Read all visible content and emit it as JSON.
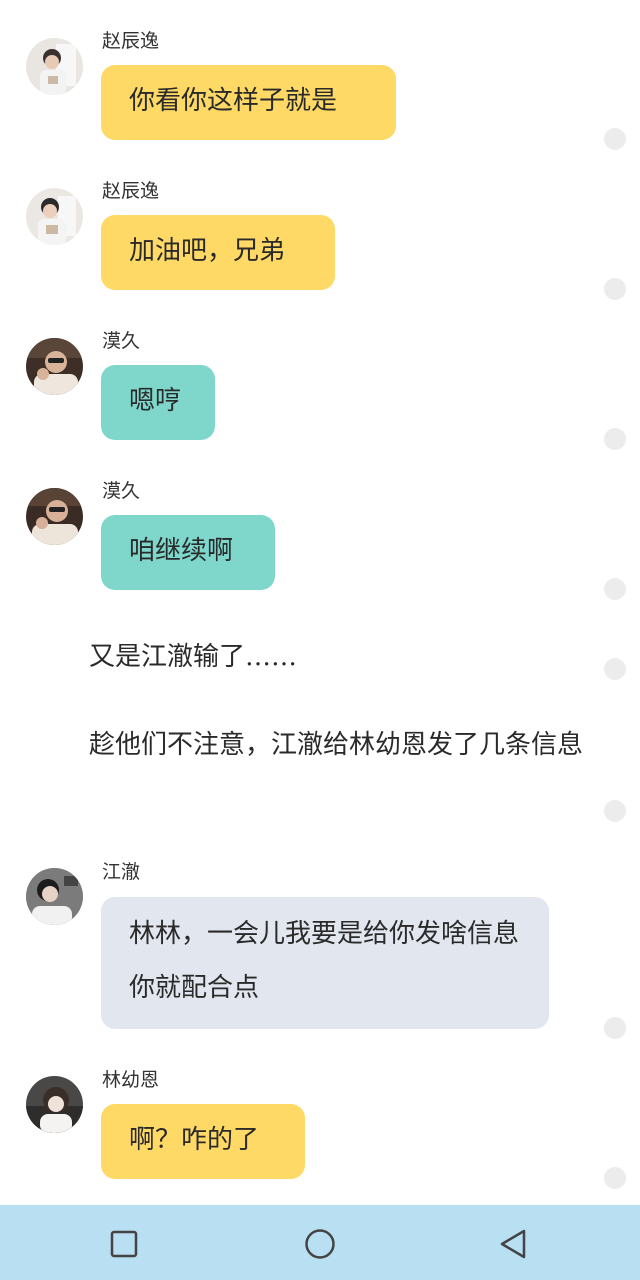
{
  "messages": [
    {
      "sender": "赵辰逸",
      "text": "你看你这样子就是",
      "color": "#ffd965"
    },
    {
      "sender": "赵辰逸",
      "text": "加油吧，兄弟",
      "color": "#ffd965"
    },
    {
      "sender": "漠久",
      "text": "嗯哼",
      "color": "#7fd7cc"
    },
    {
      "sender": "漠久",
      "text": "咱继续啊",
      "color": "#7fd7cc"
    },
    {
      "sender": "江澈",
      "text": "林林，一会儿我要是给你发啥信息你就配合点",
      "color": "#e1e6ef"
    },
    {
      "sender": "林幼恩",
      "text": "啊？咋的了",
      "color": "#ffd965"
    }
  ],
  "narration": [
    "又是江澈输了……",
    "趁他们不注意，江澈给林幼恩发了几条信息"
  ],
  "navbar": {
    "background": "#b9dff2",
    "buttons": [
      "recent-apps-icon",
      "home-icon",
      "back-icon"
    ]
  }
}
